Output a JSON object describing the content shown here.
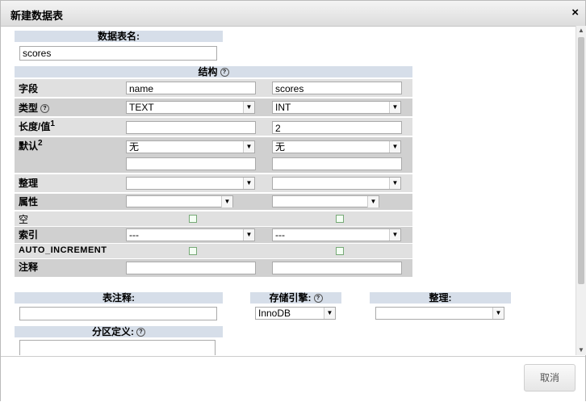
{
  "dialog": {
    "title": "新建数据表",
    "close": "×"
  },
  "table_name": {
    "label": "数据表名:",
    "value": "scores"
  },
  "structure": {
    "label": "结构",
    "help": "?"
  },
  "rows": {
    "field": {
      "label": "字段",
      "values": [
        "name",
        "scores"
      ]
    },
    "type": {
      "label": "类型",
      "help": "?",
      "values": [
        "TEXT",
        "INT"
      ]
    },
    "length": {
      "label": "长度/值",
      "sup": "1",
      "values": [
        "",
        "2"
      ]
    },
    "default": {
      "label": "默认",
      "sup": "2",
      "values": [
        "无",
        "无"
      ]
    },
    "collation": {
      "label": "整理",
      "values": [
        "",
        ""
      ]
    },
    "attributes": {
      "label": "属性",
      "values": [
        "",
        ""
      ]
    },
    "null": {
      "label": "空"
    },
    "index": {
      "label": "索引",
      "values": [
        "---",
        "---"
      ]
    },
    "auto_increment": {
      "label": "AUTO_INCREMENT"
    },
    "comment": {
      "label": "注释",
      "values": [
        "",
        ""
      ]
    }
  },
  "table_comment": {
    "label": "表注释:",
    "value": ""
  },
  "engine": {
    "label": "存储引擎:",
    "help": "?",
    "value": "InnoDB"
  },
  "collation": {
    "label": "整理:",
    "value": ""
  },
  "partition": {
    "label": "分区定义:",
    "help": "?",
    "value": ""
  },
  "footer": {
    "cancel": "取消"
  }
}
